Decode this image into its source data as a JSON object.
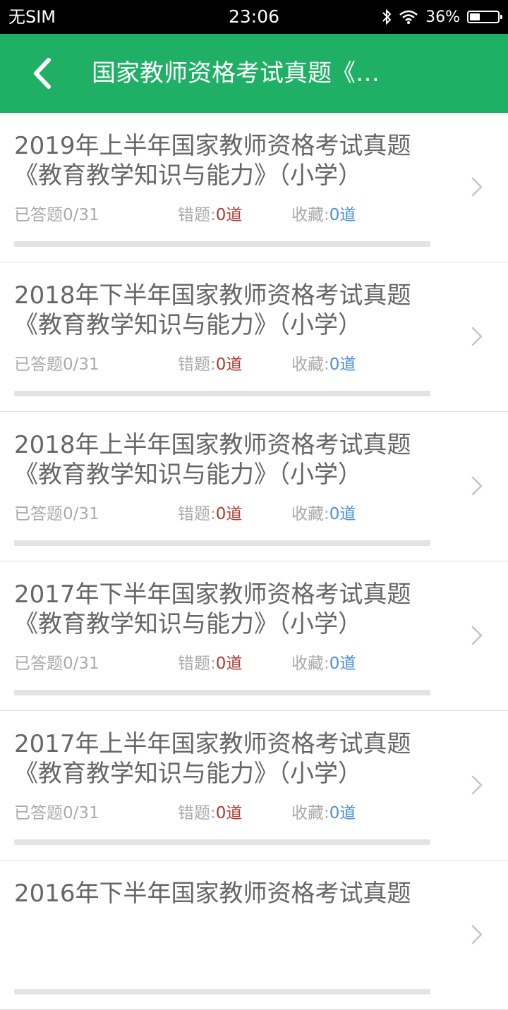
{
  "status_bar": {
    "carrier": "无SIM",
    "time": "23:06",
    "battery_percent": "36%",
    "battery_level": 0.36,
    "icons": [
      "bluetooth-icon",
      "wifi-icon",
      "battery-icon"
    ]
  },
  "nav": {
    "title": "国家教师资格考试真题《…",
    "back_icon": "chevron-left-icon",
    "background_color": "#1fb065"
  },
  "labels": {
    "answered_prefix": "已答题",
    "wrong_prefix": "错题:",
    "fav_prefix": "收藏:"
  },
  "items": [
    {
      "title": "2019年上半年国家教师资格考试真题《教育教学知识与能力》（小学）",
      "answered": "0/31",
      "wrong": "0道",
      "favorites": "0道",
      "progress": 0
    },
    {
      "title": "2018年下半年国家教师资格考试真题《教育教学知识与能力》（小学）",
      "answered": "0/31",
      "wrong": "0道",
      "favorites": "0道",
      "progress": 0
    },
    {
      "title": "2018年上半年国家教师资格考试真题《教育教学知识与能力》（小学）",
      "answered": "0/31",
      "wrong": "0道",
      "favorites": "0道",
      "progress": 0
    },
    {
      "title": "2017年下半年国家教师资格考试真题《教育教学知识与能力》（小学）",
      "answered": "0/31",
      "wrong": "0道",
      "favorites": "0道",
      "progress": 0
    },
    {
      "title": "2017年上半年国家教师资格考试真题《教育教学知识与能力》（小学）",
      "answered": "0/31",
      "wrong": "0道",
      "favorites": "0道",
      "progress": 0
    },
    {
      "title": "2016年下半年国家教师资格考试真题",
      "answered": "",
      "wrong": "",
      "favorites": "",
      "progress": 0
    }
  ]
}
